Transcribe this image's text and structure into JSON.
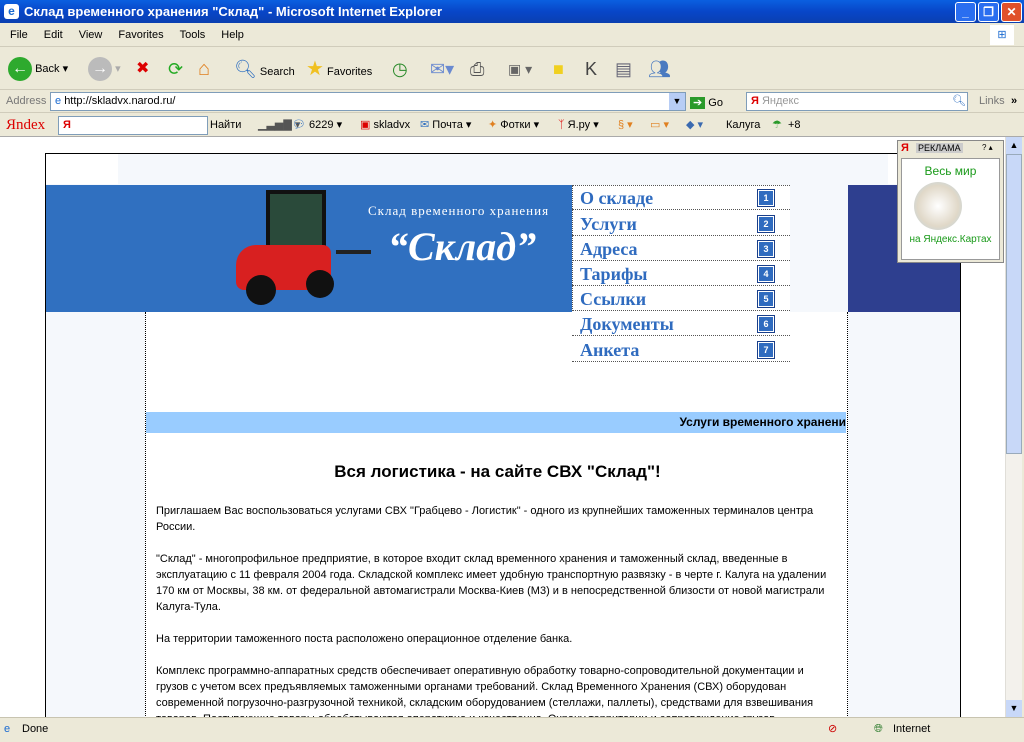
{
  "window": {
    "title": "Склад временного хранения \"Склад\" - Microsoft Internet Explorer"
  },
  "menu": [
    "File",
    "Edit",
    "View",
    "Favorites",
    "Tools",
    "Help"
  ],
  "toolbar": {
    "back": "Back",
    "search": "Search",
    "favorites": "Favorites"
  },
  "address": {
    "label": "Address",
    "url": "http://skladvx.narod.ru/",
    "go": "Go",
    "search_placeholder": "Яндекс",
    "links": "Links"
  },
  "yandex_bar": {
    "logo": "Яndex",
    "find": "Найти",
    "count": "6229",
    "user": "skladvx",
    "mail": "Почта",
    "photos": "Фотки",
    "yaru": "Я.ру",
    "city": "Калуга",
    "temp": "+8"
  },
  "ad": {
    "label": "РЕКЛАМА",
    "title": "Весь мир",
    "caption": "на Яндекс.Картах"
  },
  "site": {
    "subtitle": "Склад временного хранения",
    "name": "“Склад”",
    "nav": [
      {
        "label": "О складе",
        "num": "1"
      },
      {
        "label": "Услуги",
        "num": "2"
      },
      {
        "label": "Адреса",
        "num": "3"
      },
      {
        "label": "Тарифы",
        "num": "4"
      },
      {
        "label": "Ссылки",
        "num": "5"
      },
      {
        "label": "Документы",
        "num": "6"
      },
      {
        "label": "Анкета",
        "num": "7"
      }
    ],
    "banner": "Услуги временного хранени",
    "heading": "Вся логистика - на сайте СВХ \"Склад\"!",
    "paragraphs": [
      "Приглашаем Вас воспользоваться услугами СВХ \"Грабцево - Логистик\" - одного из крупнейших таможенных терминалов центра России.",
      "\"Склад\" - многопрофильное предприятие, в которое входит склад временного хранения и таможенный склад, введенные в эксплуатацию с 11 февраля 2004 года. Складской комплекс имеет удобную транспортную развязку - в черте г. Калуга на удалении 170 км от Москвы, 38 км. от федеральной автомагистрали Москва-Киев (М3) и в непосредственной близости от новой магистрали Калуга-Тула.",
      "На территории таможенного поста расположено операционное отделение банка.",
      "Комплекс программно-аппаратных средств обеспечивает оперативную обработку товарно-сопроводительной документации и грузов с учетом всех предъявляемых таможенными органами требований. Склад Временного Хранения (СВХ) оборудован современной погрузочно-разгрузочной техникой, складским оборудованием (стеллажи, паллеты), средствами для взвешивания товаров. Поступающие товары обрабатываются оперативно и качественно. Охрану территории и сопровождение грузов"
    ]
  },
  "status": {
    "text": "Done",
    "zone": "Internet"
  }
}
